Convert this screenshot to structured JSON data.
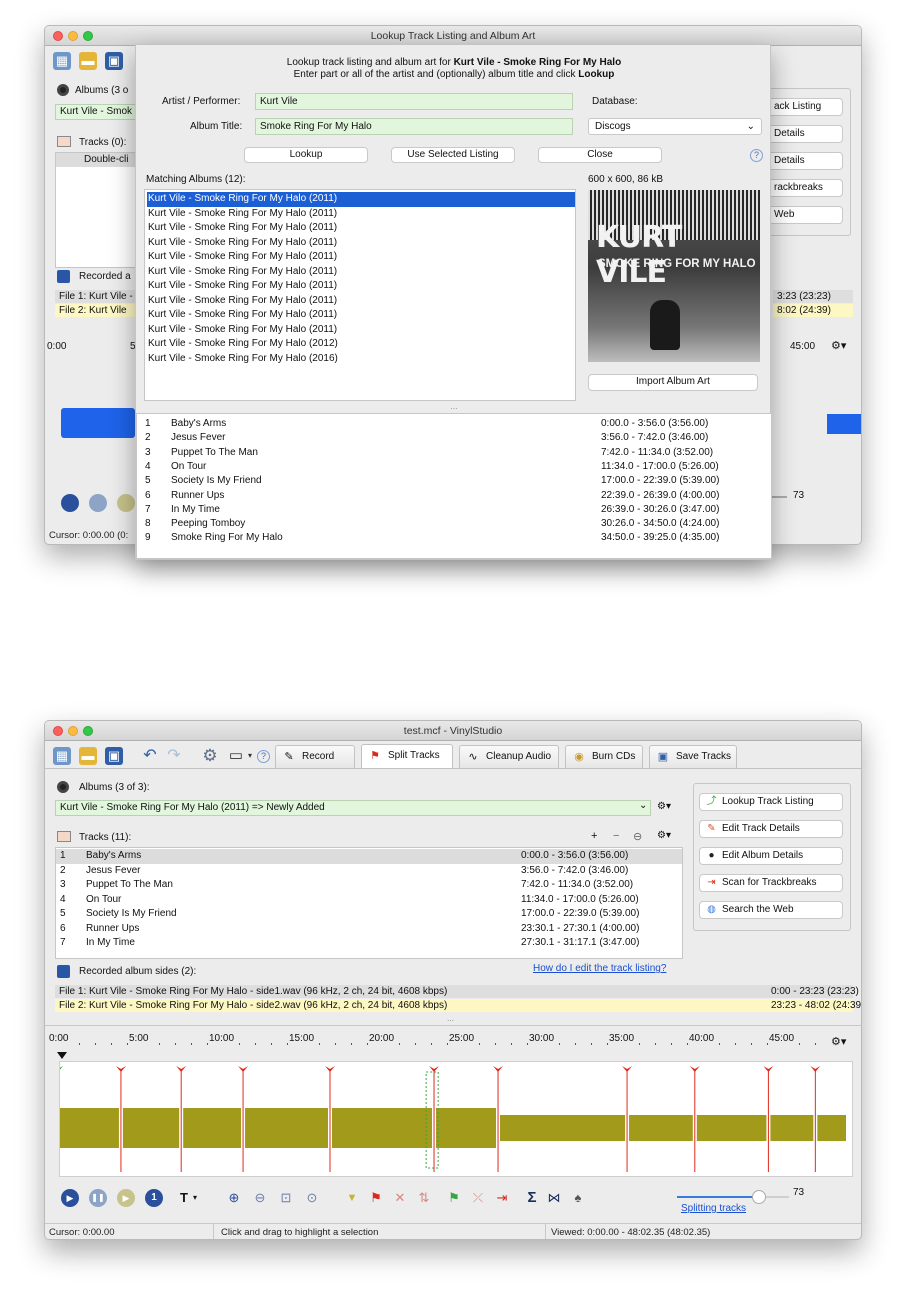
{
  "top": {
    "window_title": "Lookup Track Listing and Album Art",
    "bg_albums_label": "Albums (3 o",
    "bg_album_value": "Kurt Vile - Smok",
    "bg_tracks_label": "Tracks (0):",
    "bg_doubleclick": "Double-cli",
    "bg_recorded_label": "Recorded a",
    "bg_file1": "File 1: Kurt Vile -",
    "bg_file2": "File 2: Kurt Vile",
    "bg_ruler_0": "0:00",
    "bg_ruler_5": "5",
    "bg_ruler_45": "45:00",
    "bg_time1": "3:23 (23:23)",
    "bg_time2": "8:02 (24:39)",
    "bg_btn1": "ack Listing",
    "bg_btn2": "Details",
    "bg_btn3": "Details",
    "bg_btn4": "rackbreaks",
    "bg_btn5": "Web",
    "bg_slider_value": "73",
    "bg_cursor": "Cursor: 0:00.00 (0:",
    "dialog": {
      "heading_prefix": "Lookup track listing and album art for ",
      "heading_bold": "Kurt Vile - Smoke Ring For My Halo",
      "subheading_prefix": "Enter part or all of the artist and (optionally) album title and click ",
      "subheading_bold": "Lookup",
      "artist_label": "Artist / Performer:",
      "artist_value": "Kurt Vile",
      "album_label": "Album Title:",
      "album_value": "Smoke Ring For My Halo",
      "database_label": "Database:",
      "database_value": "Discogs",
      "lookup_button": "Lookup",
      "use_listing_button": "Use Selected Listing",
      "close_button": "Close",
      "help_glyph": "?",
      "matching_label": "Matching Albums (12):",
      "art_info": "600 x 600, 86 kB",
      "art_text_1": "KURT VILE",
      "art_text_2": "SMOKE RING FOR MY HALO",
      "import_button": "Import Album Art",
      "albums": [
        "Kurt Vile - Smoke Ring For My Halo (2011)",
        "Kurt Vile - Smoke Ring For My Halo (2011)",
        "Kurt Vile - Smoke Ring For My Halo (2011)",
        "Kurt Vile - Smoke Ring For My Halo (2011)",
        "Kurt Vile - Smoke Ring For My Halo (2011)",
        "Kurt Vile - Smoke Ring For My Halo (2011)",
        "Kurt Vile - Smoke Ring For My Halo (2011)",
        "Kurt Vile - Smoke Ring For My Halo (2011)",
        "Kurt Vile - Smoke Ring For My Halo (2011)",
        "Kurt Vile - Smoke Ring For My Halo (2011)",
        "Kurt Vile - Smoke Ring For My Halo (2012)",
        "Kurt Vile - Smoke Ring For My Halo (2016)"
      ],
      "tracks": [
        {
          "n": "1",
          "title": "Baby's Arms",
          "time": "0:00.0 - 3:56.0  (3:56.00)"
        },
        {
          "n": "2",
          "title": "Jesus Fever",
          "time": "3:56.0 - 7:42.0  (3:46.00)"
        },
        {
          "n": "3",
          "title": "Puppet To The Man",
          "time": "7:42.0 - 11:34.0  (3:52.00)"
        },
        {
          "n": "4",
          "title": "On Tour",
          "time": "11:34.0 - 17:00.0  (5:26.00)"
        },
        {
          "n": "5",
          "title": "Society Is My Friend",
          "time": "17:00.0 - 22:39.0  (5:39.00)"
        },
        {
          "n": "6",
          "title": "Runner Ups",
          "time": "22:39.0 - 26:39.0  (4:00.00)"
        },
        {
          "n": "7",
          "title": "In My Time",
          "time": "26:39.0 - 30:26.0  (3:47.00)"
        },
        {
          "n": "8",
          "title": "Peeping Tomboy",
          "time": "30:26.0 - 34:50.0  (4:24.00)"
        },
        {
          "n": "9",
          "title": "Smoke Ring For My Halo",
          "time": "34:50.0 - 39:25.0  (4:35.00)"
        }
      ]
    }
  },
  "main": {
    "window_title": "test.mcf - VinylStudio",
    "tabs": [
      {
        "label": "Record",
        "icon": "microphone-icon"
      },
      {
        "label": "Split Tracks",
        "icon": "split-flag-icon"
      },
      {
        "label": "Cleanup Audio",
        "icon": "waveform-icon"
      },
      {
        "label": "Burn CDs",
        "icon": "disc-icon"
      },
      {
        "label": "Save Tracks",
        "icon": "save-tracks-icon"
      }
    ],
    "albums_label": "Albums (3 of 3):",
    "album_value": "Kurt Vile - Smoke Ring For My Halo (2011) => Newly Added",
    "tracks_label": "Tracks (11):",
    "tracks": [
      {
        "n": "1",
        "title": "Baby's Arms",
        "time": "0:00.0 - 3:56.0  (3:56.00)"
      },
      {
        "n": "2",
        "title": "Jesus Fever",
        "time": "3:56.0 - 7:42.0  (3:46.00)"
      },
      {
        "n": "3",
        "title": "Puppet To The Man",
        "time": "7:42.0 - 11:34.0  (3:52.00)"
      },
      {
        "n": "4",
        "title": "On Tour",
        "time": "11:34.0 - 17:00.0  (5:26.00)"
      },
      {
        "n": "5",
        "title": "Society Is My Friend",
        "time": "17:00.0 - 22:39.0  (5:39.00)"
      },
      {
        "n": "6",
        "title": "Runner Ups",
        "time": "23:30.1 - 27:30.1  (4:00.00)"
      },
      {
        "n": "7",
        "title": "In My Time",
        "time": "27:30.1 - 31:17.1  (3:47.00)"
      }
    ],
    "side_buttons": [
      {
        "label": "Lookup Track Listing",
        "icon": "lookup-icon"
      },
      {
        "label": "Edit Track Details",
        "icon": "edit-icon"
      },
      {
        "label": "Edit Album Details",
        "icon": "record-disc-icon"
      },
      {
        "label": "Scan for Trackbreaks",
        "icon": "scan-icon"
      },
      {
        "label": "Search the Web",
        "icon": "globe-icon"
      }
    ],
    "recorded_label": "Recorded album sides (2):",
    "help_link": "How do I edit the track listing?",
    "files": [
      {
        "name": "File 1: Kurt Vile - Smoke Ring For My Halo - side1.wav (96 kHz, 2 ch, 24 bit, 4608 kbps)",
        "time": "0:00 - 23:23 (23:23)"
      },
      {
        "name": "File 2: Kurt Vile - Smoke Ring For My Halo - side2.wav (96 kHz, 2 ch, 24 bit, 4608 kbps)",
        "time": "23:23 - 48:02 (24:39)"
      }
    ],
    "ruler": [
      "0:00",
      "5:00",
      "10:00",
      "15:00",
      "20:00",
      "25:00",
      "30:00",
      "35:00",
      "40:00",
      "45:00"
    ],
    "slider_value": "73",
    "slider_fraction": 0.73,
    "splitting_link": "Splitting tracks",
    "status_cursor": "Cursor: 0:00.00",
    "status_hint": "Click and drag to highlight a selection",
    "status_viewed": "Viewed: 0:00.00 - 48:02.35 (48:02.35)",
    "sigma_glyph": "Σ",
    "waveform_color": "#a29a1a",
    "selection_color": "#1c5fd4",
    "marker_color": "#e0281e",
    "marker_start_color": "#27a32e"
  }
}
